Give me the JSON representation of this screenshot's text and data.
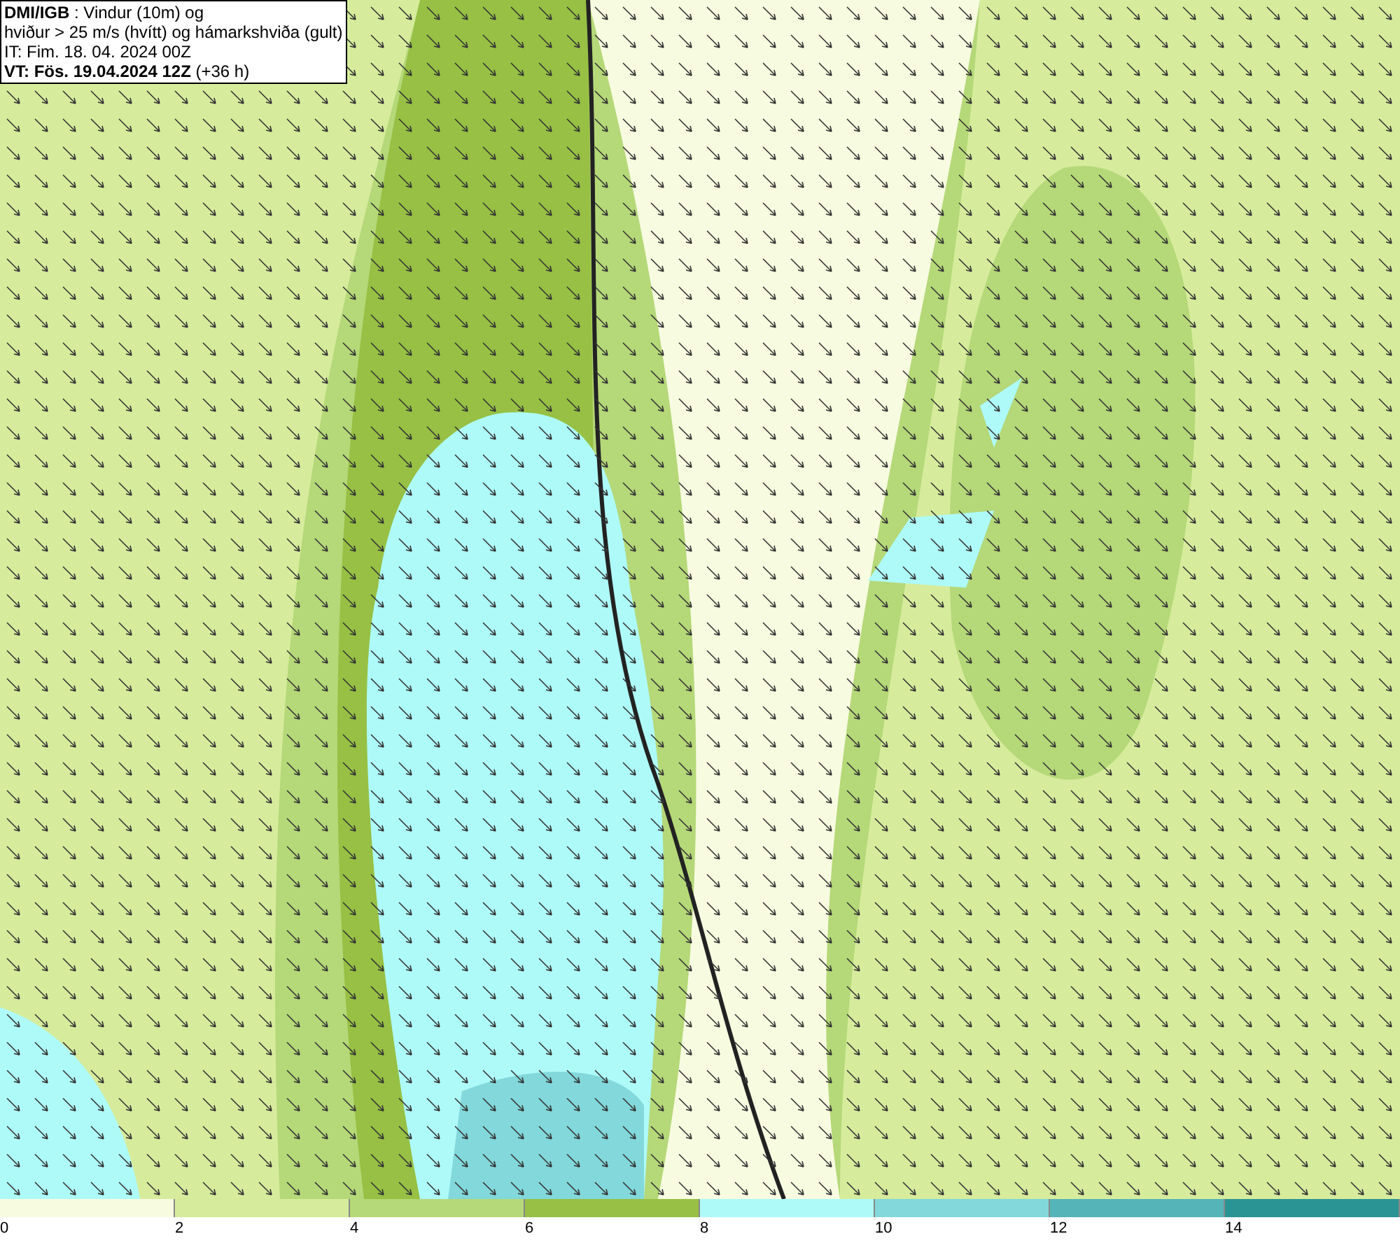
{
  "header": {
    "lines": [
      "**DMI/IGB** : Vindur (10m) og",
      "hviður > 25 m/s (hvítt) og hámarkshviða (gult)",
      "IT: Fim. 18. 04. 2024 00Z",
      "**VT: Fös. 19.04.2024 12Z** (+36 h)"
    ]
  },
  "legend": [
    {
      "label": "0",
      "color": "#f7fbe0"
    },
    {
      "label": "2",
      "color": "#d6ec9c"
    },
    {
      "label": "4",
      "color": "#b5d878"
    },
    {
      "label": "6",
      "color": "#97c044"
    },
    {
      "label": "8",
      "color": "#aefaf8"
    },
    {
      "label": "10",
      "color": "#82d8da"
    },
    {
      "label": "12",
      "color": "#55b4b8"
    },
    {
      "label": "14",
      "color": "#2a9494"
    }
  ]
}
